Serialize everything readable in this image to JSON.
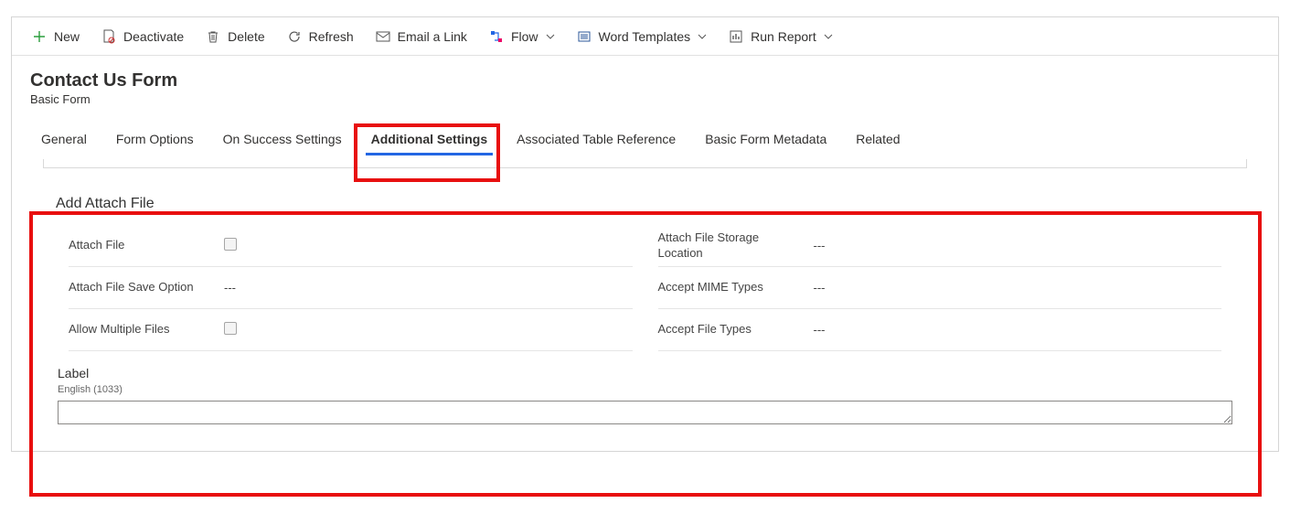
{
  "commandBar": {
    "new": "New",
    "deactivate": "Deactivate",
    "delete": "Delete",
    "refresh": "Refresh",
    "emailLink": "Email a Link",
    "flow": "Flow",
    "wordTemplates": "Word Templates",
    "runReport": "Run Report"
  },
  "header": {
    "title": "Contact Us Form",
    "subtitle": "Basic Form"
  },
  "tabs": {
    "general": "General",
    "formOptions": "Form Options",
    "onSuccess": "On Success Settings",
    "additional": "Additional Settings",
    "assocTable": "Associated Table Reference",
    "metadata": "Basic Form Metadata",
    "related": "Related"
  },
  "section": {
    "title": "Add Attach File",
    "left": {
      "attachFile": "Attach File",
      "saveOption": "Attach File Save Option",
      "saveOptionVal": "---",
      "allowMultiple": "Allow Multiple Files"
    },
    "right": {
      "storage": "Attach File Storage Location",
      "storageVal": "---",
      "mime": "Accept MIME Types",
      "mimeVal": "---",
      "fileTypes": "Accept File Types",
      "fileTypesVal": "---"
    },
    "label": {
      "title": "Label",
      "lang": "English (1033)",
      "value": ""
    }
  }
}
